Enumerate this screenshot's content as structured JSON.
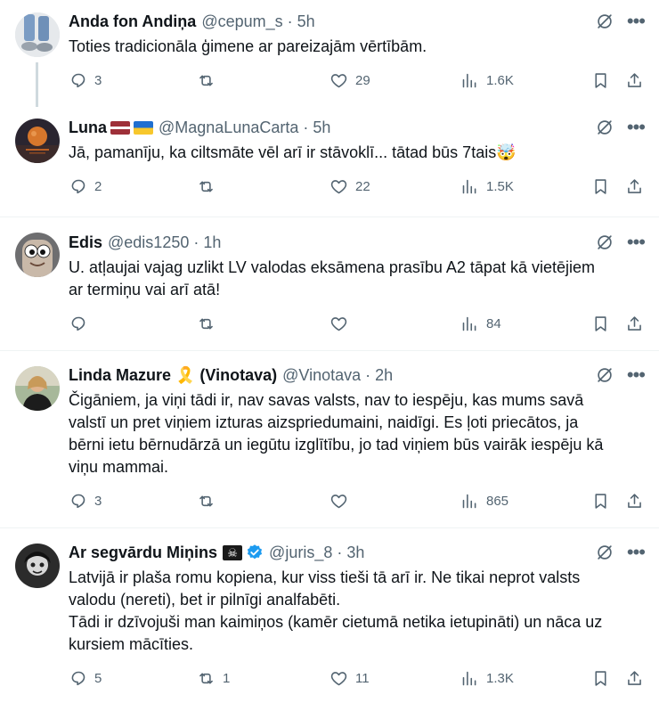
{
  "tweets": [
    {
      "name": "Anda fon Andiņa",
      "handle": "@cepum_s",
      "time": "5h",
      "text": [
        "Toties tradicionāla ģimene ar pareizajām vērtībām."
      ],
      "replies": "3",
      "reposts": "",
      "likes": "29",
      "views": "1.6K"
    },
    {
      "name": "Luna",
      "handle": "@MagnaLunaCarta",
      "time": "5h",
      "text": [
        "Jā, pamanīju, ka ciltsmāte vēl arī ir stāvoklī... tātad būs 7tais🤯"
      ],
      "replies": "2",
      "reposts": "",
      "likes": "22",
      "views": "1.5K"
    },
    {
      "name": "Edis",
      "handle": "@edis1250",
      "time": "1h",
      "text": [
        "U. atļaujai vajag uzlikt LV valodas eksāmena prasību A2 tāpat kā vietējiem",
        "ar termiņu vai arī atā!"
      ],
      "replies": "",
      "reposts": "",
      "likes": "",
      "views": "84"
    },
    {
      "name": "Linda Mazure 🎗️ (Vinotava)",
      "handle": "@Vinotava",
      "time": "2h",
      "text": [
        "Čigāniem, ja viņi tādi ir, nav savas valsts, nav to iespēju, kas mums savā",
        "valstī un pret viņiem izturas aizspriedumaini, naidīgi. Es ļoti priecātos, ja",
        "bērni ietu bērnudārzā un iegūtu izglītību, jo tad viņiem būs vairāk iespēju kā",
        "viņu mammai."
      ],
      "replies": "3",
      "reposts": "",
      "likes": "",
      "views": "865"
    },
    {
      "name": "Ar segvārdu Miņins",
      "handle": "@juris_8",
      "time": "3h",
      "text": [
        "Latvijā ir plaša romu kopiena, kur viss tieši tā arī ir. Ne tikai neprot valsts",
        "valodu (nereti), bet ir pilnīgi analfabēti.",
        "Tādi ir dzīvojuši man kaimiņos (kamēr cietumā netika ietupināti) un nāca uz",
        "kursiem mācīties."
      ],
      "replies": "5",
      "reposts": "1",
      "likes": "11",
      "views": "1.3K"
    }
  ],
  "icons": {
    "reply": "reply-icon",
    "repost": "repost-icon",
    "like": "heart-icon",
    "views": "views-icon",
    "bookmark": "bookmark-icon",
    "share": "share-icon",
    "grok": "grok-icon",
    "more": "more-icon",
    "verified": "verified-icon",
    "pirate": "skull-crossbones-icon"
  },
  "colors": {
    "text": "#0f1419",
    "secondary": "#536471",
    "border": "#eff3f4",
    "thread_line": "#cfd9de",
    "verified": "#1d9bf0"
  }
}
